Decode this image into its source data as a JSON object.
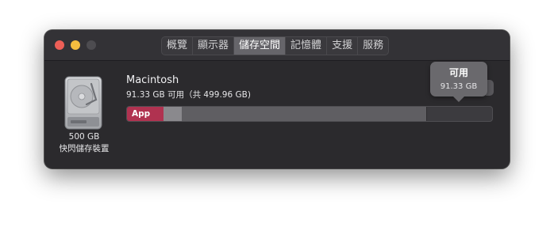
{
  "tabs": [
    "概覽",
    "顯示器",
    "儲存空間",
    "記憶體",
    "支援",
    "服務"
  ],
  "active_tab": 2,
  "disk": {
    "size_label": "500 GB",
    "type_label": "快閃儲存裝置",
    "icon": "hard-drive-icon"
  },
  "volume": {
    "name": "Macintosh",
    "info": "91.33 GB 可用（共 499.96 GB)"
  },
  "usage_bar": {
    "app_label": "App",
    "segments": [
      {
        "name": "app",
        "fraction": 0.1,
        "color": "#b03250"
      },
      {
        "name": "other-light",
        "fraction": 0.05,
        "color": "#8a898d"
      },
      {
        "name": "system",
        "fraction": 0.67,
        "color": "#5f5e62"
      },
      {
        "name": "available",
        "fraction": 0.18,
        "color": "#3c3b3f"
      }
    ]
  },
  "tooltip": {
    "title": "可用",
    "value": "91.33 GB"
  },
  "colors": {
    "window_bg": "#2b2a2d",
    "accent_app": "#b03250",
    "traffic_close": "#ed5f57",
    "traffic_minimize": "#f5bd3f",
    "traffic_zoom_disabled": "#4d4c50"
  }
}
